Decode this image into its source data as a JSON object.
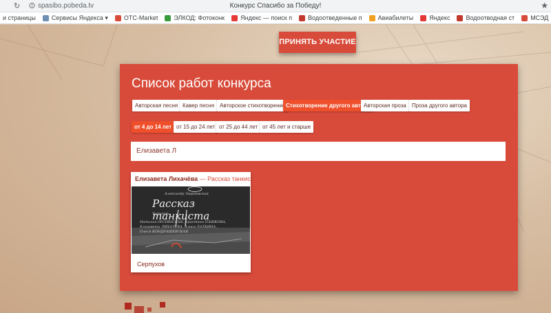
{
  "browser": {
    "url": "spasibo.pobeda.tv",
    "title": "Конкурс Спасибо за Победу!",
    "bookmarks": [
      {
        "label": "и страницы",
        "icon": "none",
        "color": ""
      },
      {
        "label": "Сервисы Яндекса ▾",
        "icon": "yandex-services-icon",
        "color": "#6f8fb3"
      },
      {
        "label": "OTC-Market",
        "icon": "otc-icon",
        "color": "#d84b3a"
      },
      {
        "label": "ЭЛКОД: Фотоконк",
        "icon": "elkod-icon",
        "color": "#3a9b3a"
      },
      {
        "label": "Яндекс — поиск п",
        "icon": "yandex-icon",
        "color": "#e53935"
      },
      {
        "label": "Водоотведенные п",
        "icon": "water-icon",
        "color": "#c0392b"
      },
      {
        "label": "Авиабилеты",
        "icon": "plane-icon",
        "color": "#f0a020"
      },
      {
        "label": "Яндекс",
        "icon": "yandex-icon",
        "color": "#e53935"
      },
      {
        "label": "Водоотводная ст",
        "icon": "water-icon",
        "color": "#c0392b"
      },
      {
        "label": "МСЭД",
        "icon": "msed-icon",
        "color": "#d84b3a"
      }
    ]
  },
  "page": {
    "join_button": "ПРИНЯТЬ УЧАСТИЕ",
    "list_title": "Список работ конкурса",
    "categories": [
      {
        "label": "Авторская песня",
        "active": false
      },
      {
        "label": "Кавер песня",
        "active": false
      },
      {
        "label": "Авторское стихотворение",
        "active": false
      },
      {
        "label": "Стихотворение другого автора",
        "active": true
      },
      {
        "label": "Авторская проза",
        "active": false
      },
      {
        "label": "Проза другого автора",
        "active": false
      }
    ],
    "age_groups": [
      {
        "label": "от 4 до 14 лет",
        "active": true
      },
      {
        "label": "от 15 до 24 лет",
        "active": false
      },
      {
        "label": "от 25 до 44 лет",
        "active": false
      },
      {
        "label": "от 45 лет и старше",
        "active": false
      }
    ],
    "search": {
      "value": "Елизавета Л"
    },
    "cards": [
      {
        "author": "Елизавета Лихачёва",
        "separator": "—",
        "work": "Рассказ танкиста",
        "poster_title": "Рассказ танкиста",
        "poster_author": "Александр Твардовский",
        "poster_reads": "Читают:",
        "poster_cast": "Наталья ПОЛЯНСКАЯ, Кристина ПАШКОВА,\nЕлизавета ЛИХАЧЕВА, Алиса ЛАТКИНА,\nОлеся КОНДРАШЕВСКАЯ",
        "city": "Серпухов"
      }
    ]
  },
  "colors": {
    "accent": "#d84b3a",
    "active_chip": "#ef4f2b",
    "text_dark_red": "#8b2a20"
  }
}
